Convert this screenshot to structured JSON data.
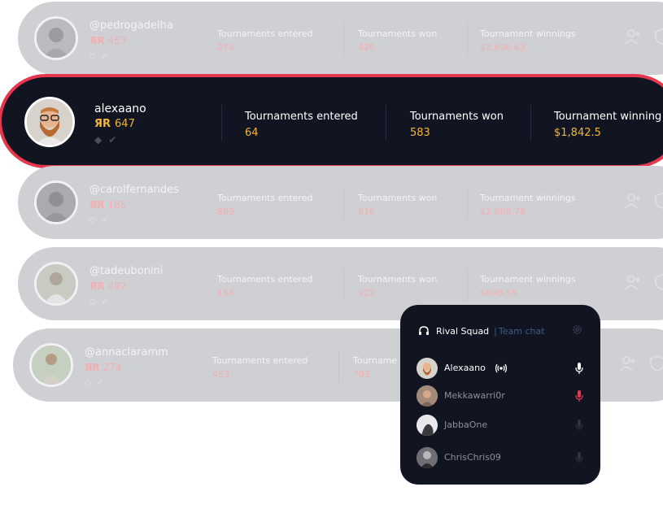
{
  "labels": {
    "entered": "Tournaments entered",
    "won": "Tournaments won",
    "winnings": "Tournament winnings",
    "winnings_clipped": "Tournament winning",
    "won_clipped": "Tourname"
  },
  "rating_prefix": "ЯR",
  "players": [
    {
      "username": "@pedrogadelha",
      "rating": "453",
      "entered": "274",
      "won": "426",
      "winnings": "$2,696.63"
    },
    {
      "username": "alexaano",
      "rating": "647",
      "entered": "64",
      "won": "583",
      "winnings": "$1,842.5"
    },
    {
      "username": "@carolfernandes",
      "rating": "185",
      "entered": "883",
      "won": "816",
      "winnings": "$2,868.78"
    },
    {
      "username": "@tadeubonini",
      "rating": "492",
      "entered": "154",
      "won": "922",
      "winnings": "$698.55"
    },
    {
      "username": "@annaclaramm",
      "rating": "274",
      "entered": "453",
      "won": "703",
      "winnings": ""
    }
  ],
  "chat": {
    "team": "Rival Squad",
    "separator": "|",
    "tab": "Team chat",
    "members": [
      {
        "name": "Alexaano",
        "speaking": true,
        "mic": "on"
      },
      {
        "name": "Mekkawarri0r",
        "speaking": false,
        "mic": "muted"
      },
      {
        "name": "JabbaOne",
        "speaking": false,
        "mic": "off"
      },
      {
        "name": "ChrisChris09",
        "speaking": false,
        "mic": "off"
      }
    ]
  },
  "icons": [
    "headset-icon",
    "gear-icon",
    "mic-icon",
    "broadcast-icon",
    "add-user-icon",
    "shield-icon",
    "check-icon"
  ],
  "colors": {
    "accent": "#e5384f",
    "gold": "#f5b43a",
    "panel": "#111522",
    "muted_row": "#cfd0d4",
    "rating_faded": "#f3aeb2",
    "chat_link": "#3f5a83"
  }
}
